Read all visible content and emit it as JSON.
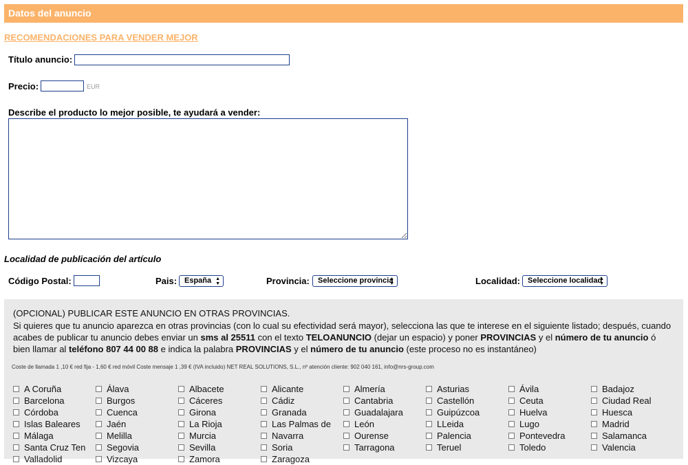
{
  "header": {
    "title": "Datos del anuncio"
  },
  "recommendations_link": "RECOMENDACIONES PARA VENDER MEJOR",
  "form": {
    "title_label": "Título anuncio:",
    "title_value": "",
    "price_label": "Precio:",
    "price_value": "",
    "price_currency": "EUR",
    "description_label": "Describe el producto lo mejor posible, te ayudará a vender:",
    "description_value": ""
  },
  "location": {
    "section_title": "Localidad de publicación del artículo",
    "postal_label": "Código Postal:",
    "postal_value": "",
    "country_label": "Pais:",
    "country_selected": "España",
    "province_label": "Provincia:",
    "province_selected": "Seleccione provincia",
    "locality_label": "Localidad:",
    "locality_selected": "Seleccione localidad"
  },
  "optional": {
    "title": "(OPCIONAL) PUBLICAR ESTE ANUNCIO EN OTRAS PROVINCIAS.",
    "desc_line1": "Si quieres que tu anuncio aparezca en otras provincias (con lo cual su efectividad será mayor), selecciona las que te interese en el siguiente listado; después, cuando",
    "desc_p1": "acabes de publicar tu anuncio debes enviar un ",
    "desc_b1": "sms al 25511",
    "desc_p2": " con el texto ",
    "desc_b2": "TELOANUNCIO",
    "desc_p3": " (dejar un espacio) y poner ",
    "desc_b3": "PROVINCIAS",
    "desc_p4": " y el ",
    "desc_b4": "número de tu anuncio",
    "desc_p5": " ó",
    "desc_p6": "bien llamar al ",
    "desc_b5": "teléfono 807 44 00 88",
    "desc_p7": " e indica la palabra ",
    "desc_b6": "PROVINCIAS",
    "desc_p8": " y el ",
    "desc_b7": "número de tu anuncio",
    "desc_p9": " (este proceso no es instantáneo)",
    "cost_note": "Coste de llamada 1 ,10 € red fija - 1,60 € red móvil Coste mensaje 1 ,39 € (IVA incluido) NET REAL SOLUTIONS, S.L., nº atención cliente: 902 040 161, info@nrs-group.com",
    "provinces": [
      [
        "A Coruña",
        "Álava",
        "Albacete",
        "Alicante",
        "Almería",
        "Asturias",
        "Ávila",
        "Badajoz"
      ],
      [
        "Barcelona",
        "Burgos",
        "Cáceres",
        "Cádiz",
        "Cantabria",
        "Castellón",
        "Ceuta",
        "Ciudad Real"
      ],
      [
        "Córdoba",
        "Cuenca",
        "Girona",
        "Granada",
        "Guadalajara",
        "Guipúzcoa",
        "Huelva",
        "Huesca"
      ],
      [
        "Islas Baleares",
        "Jaén",
        "La Rioja",
        "Las Palmas de",
        "León",
        "LLeida",
        "Lugo",
        "Madrid"
      ],
      [
        "Málaga",
        "Melilla",
        "Murcia",
        "Navarra",
        "Ourense",
        "Palencia",
        "Pontevedra",
        "Salamanca"
      ],
      [
        "Santa Cruz Ten",
        "Segovia",
        "Sevilla",
        "Soria",
        "Tarragona",
        "Teruel",
        "Toledo",
        "Valencia"
      ],
      [
        "Valladolid",
        "Vizcaya",
        "Zamora",
        "Zaragoza"
      ]
    ]
  }
}
